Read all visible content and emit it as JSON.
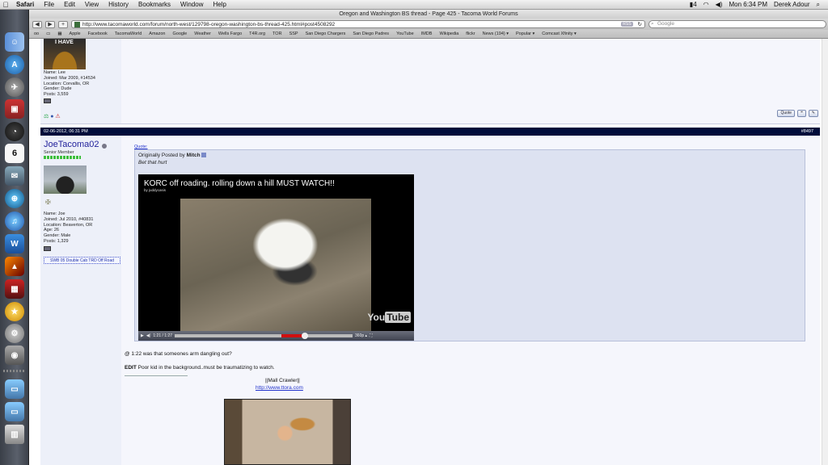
{
  "menubar": {
    "apple": "",
    "items": [
      "Safari",
      "File",
      "Edit",
      "View",
      "History",
      "Bookmarks",
      "Window",
      "Help"
    ],
    "status": {
      "battery": "4",
      "time": "Mon 6:34 PM",
      "user": "Derek Adour"
    }
  },
  "window": {
    "title": "Oregon and Washington BS thread - Page 425 - Tacoma World Forums"
  },
  "toolbar": {
    "back": "◀",
    "forward": "▶",
    "add": "+",
    "url": "http://www.tacomaworld.com/forum/north-west/129798-oregon-washington-bs-thread-425.html#post4508292",
    "rss": "RSS",
    "search_placeholder": "Google"
  },
  "bookmarks": [
    "Apple",
    "Facebook",
    "TacomaWorld",
    "Amazon",
    "Google",
    "Weather",
    "Wells Fargo",
    "T4R.org",
    "TOR",
    "SSP",
    "San Diego Chargers",
    "San Diego Padres",
    "YouTube",
    "IMDB",
    "Wikipedia",
    "flickr",
    "News (194) ▾",
    "Popular ▾",
    "Comcast Xfinity ▾"
  ],
  "dock_icons": [
    "finder-icon",
    "app-store-icon",
    "launchpad-icon",
    "photo-booth-icon",
    "dashboard-icon",
    "ical-icon",
    "mail-icon",
    "safari-icon",
    "itunes-icon",
    "word-icon",
    "iphoto-icon",
    "photo-icon",
    "imovie-icon",
    "system-preferences-icon",
    "facetime-icon",
    "applications-icon",
    "documents-icon",
    "trash-icon"
  ],
  "ical_day": "6",
  "prev_post": {
    "avatar_text": "I HAVE",
    "profile": [
      "Name: Lee",
      "Joined: Mar 2009, #14534",
      "Location: Corvallis, OR",
      "Gender: Dude",
      "Posts: 3,559"
    ],
    "buttons": [
      "Quote"
    ]
  },
  "post": {
    "date": "02-06-2012, 06:31 PM",
    "number": "#8497",
    "username": "JoeTacoma02",
    "user_title": "Senior Member",
    "profile": [
      "Name: Joe",
      "Joined: Jul 2010, #40831",
      "Location: Beaverton, OR",
      "Age: 26",
      "Gender: Male",
      "Posts: 1,329"
    ],
    "sig_car": "SWB 05 Double Cab TRD Off Road",
    "quote_label": "Quote:",
    "quote_originally": "Originally Posted by",
    "quote_author": "Mitch",
    "quote_text": "Bet that hurt",
    "video": {
      "title": "KORC off roading. rolling down a hill MUST WATCH!!",
      "channel": "by juddycasis",
      "time": "1:21 / 1:27",
      "quality": "360p ▴",
      "played": 0.73,
      "logo_you": "You",
      "logo_tube": "Tube"
    },
    "body_line1": "@ 1:22 was that someones arm dangling out?",
    "edit_label": "EDIT",
    "edit_text": " Poor kid in the background..must be traumatizing to watch.",
    "signature_name": "||Mall Crawler||",
    "signature_link": "http://www.ttora.com"
  }
}
